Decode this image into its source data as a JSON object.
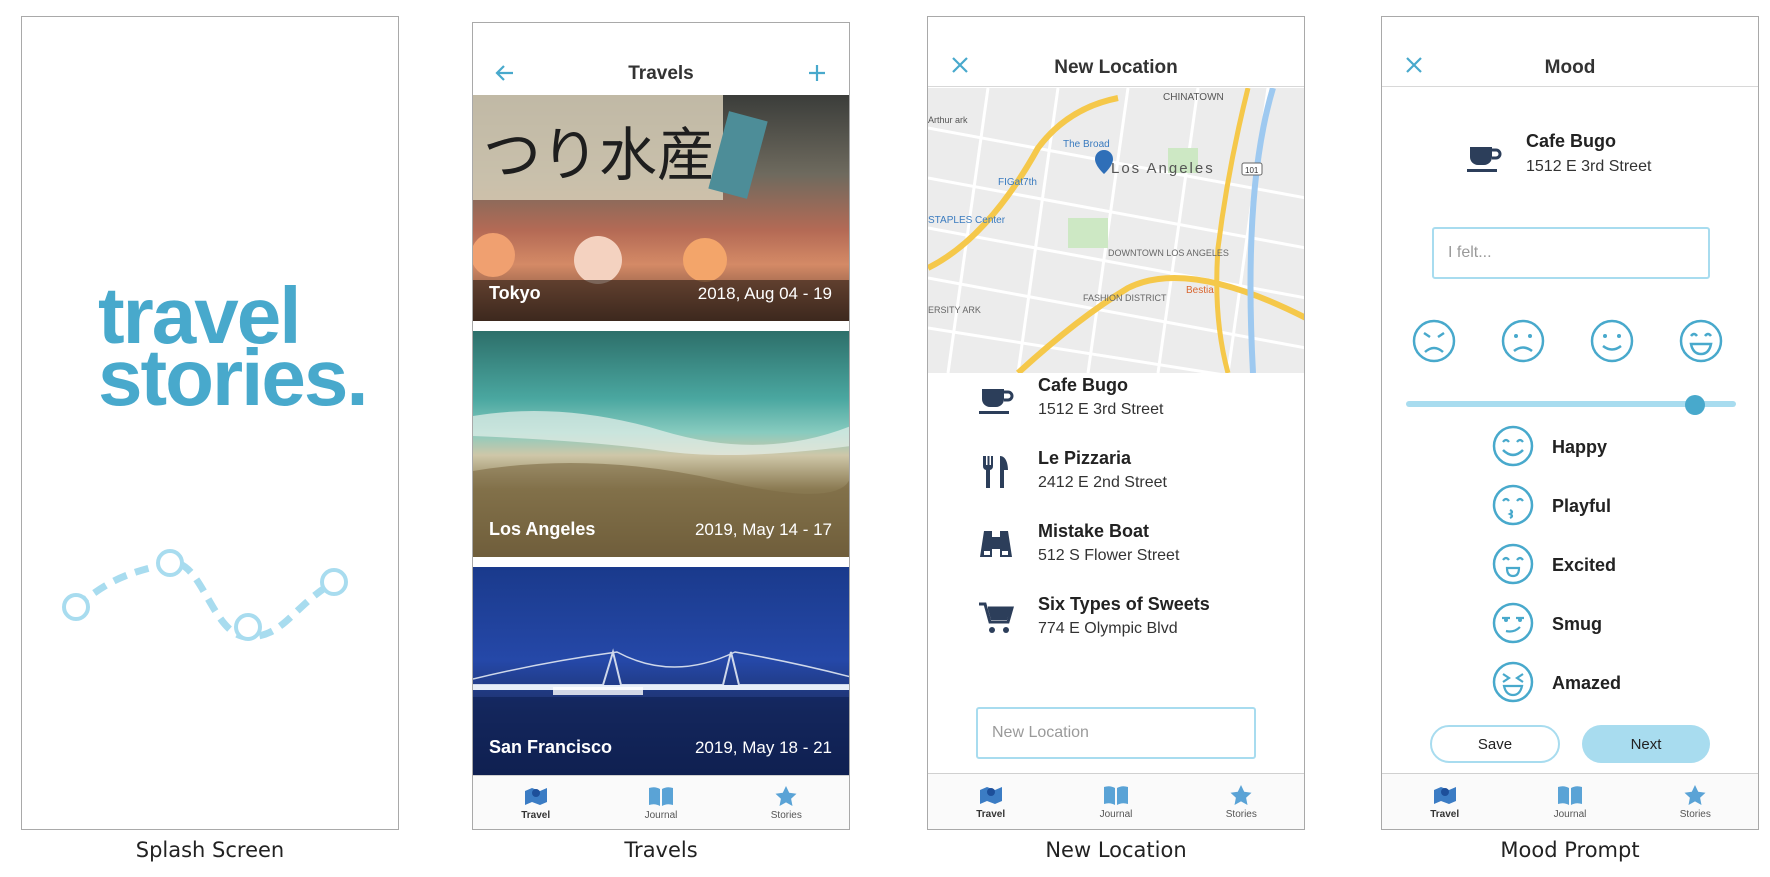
{
  "colors": {
    "accent": "#48a9cc",
    "light_accent": "#a8dcef",
    "icon_dark": "#2c3e5a",
    "tab_icon": "#5aa3d6"
  },
  "captions": [
    "Splash Screen",
    "Travels",
    "New Location",
    "Mood Prompt"
  ],
  "splash": {
    "logo_line1": "travel",
    "logo_line2": "stories."
  },
  "travels": {
    "title": "Travels",
    "back_icon": "arrow-left-icon",
    "add_icon": "plus-icon",
    "cards": [
      {
        "name": "Tokyo",
        "date": "2018, Aug 04 - 19"
      },
      {
        "name": "Los Angeles",
        "date": "2019, May 14 - 17"
      },
      {
        "name": "San Francisco",
        "date": "2019, May 18 - 21"
      }
    ]
  },
  "tabs": [
    {
      "label": "Travel",
      "icon": "map-icon"
    },
    {
      "label": "Journal",
      "icon": "book-icon"
    },
    {
      "label": "Stories",
      "icon": "star-icon"
    }
  ],
  "new_location": {
    "title": "New Location",
    "close_icon": "close-icon",
    "map_labels": {
      "city": "Los Angeles",
      "chinatown": "CHINATOWN",
      "downtown": "DOWNTOWN LOS ANGELES",
      "fashion": "FASHION DISTRICT",
      "broad": "The Broad",
      "figat": "FIGat7th",
      "staples": "STAPLES Center",
      "bestia": "Bestia",
      "arthur": "Arthur ark",
      "ersity": "ERSITY ARK",
      "hwy": "101"
    },
    "places": [
      {
        "name": "Cafe Bugo",
        "address": "1512 E 3rd Street",
        "icon": "coffee-cup-icon"
      },
      {
        "name": "Le Pizzaria",
        "address": "2412 E 2nd Street",
        "icon": "fork-knife-icon"
      },
      {
        "name": "Mistake Boat",
        "address": "512 S Flower Street",
        "icon": "binoculars-icon"
      },
      {
        "name": "Six Types of Sweets",
        "address": "774 E Olympic Blvd",
        "icon": "cart-icon"
      }
    ],
    "input_placeholder": "New Location"
  },
  "mood": {
    "title": "Mood",
    "place_name": "Cafe Bugo",
    "place_address": "1512 E 3rd Street",
    "felt_placeholder": "I felt...",
    "slider_value": 0.9,
    "scale_faces": [
      "very-sad-face-icon",
      "sad-face-icon",
      "smile-face-icon",
      "grin-face-icon"
    ],
    "options": [
      {
        "label": "Happy",
        "icon": "happy-face-icon"
      },
      {
        "label": "Playful",
        "icon": "playful-face-icon"
      },
      {
        "label": "Excited",
        "icon": "excited-face-icon"
      },
      {
        "label": "Smug",
        "icon": "smug-face-icon"
      },
      {
        "label": "Amazed",
        "icon": "amazed-face-icon"
      }
    ],
    "save_label": "Save",
    "next_label": "Next"
  }
}
